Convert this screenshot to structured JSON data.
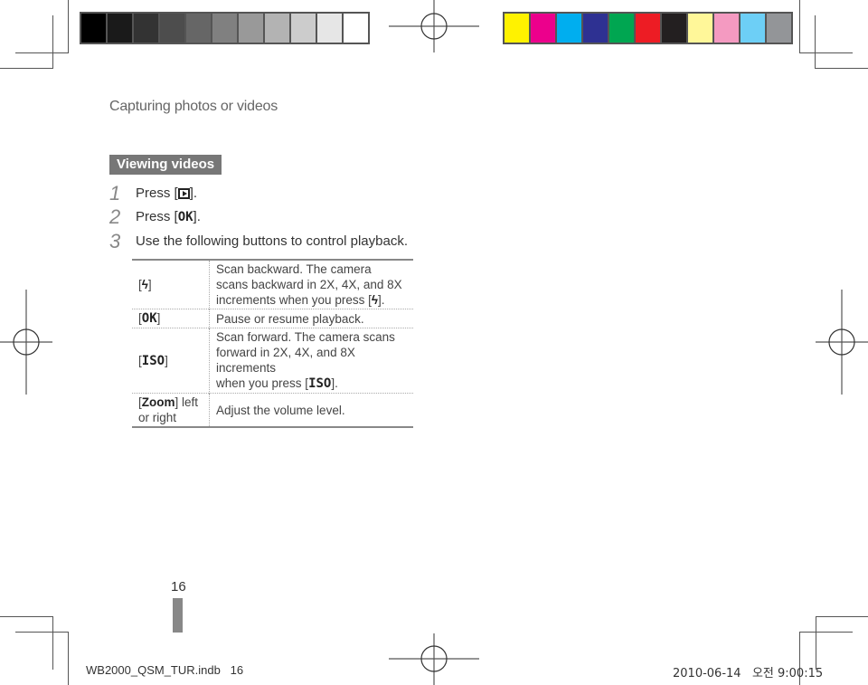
{
  "print_marks": {
    "grayscale_swatches": [
      "#000000",
      "#1a1a1a",
      "#333333",
      "#4d4d4d",
      "#666666",
      "#808080",
      "#999999",
      "#b3b3b3",
      "#cccccc",
      "#e6e6e6",
      "#ffffff"
    ],
    "color_swatches": [
      "#fff200",
      "#ec008c",
      "#00aeef",
      "#2e3192",
      "#00a651",
      "#ed1c24",
      "#231f20",
      "#fff799",
      "#f49ac1",
      "#6dcff6",
      "#939598"
    ]
  },
  "header": {
    "section_title": "Capturing photos or videos"
  },
  "main": {
    "heading": "Viewing videos",
    "steps": [
      {
        "num": "1",
        "before": "Press [",
        "icon": "play-icon",
        "after": "]."
      },
      {
        "num": "2",
        "before": "Press [",
        "key": "OK",
        "after": "]."
      },
      {
        "num": "3",
        "text": "Use the following buttons to control playback."
      }
    ],
    "table": {
      "rows": [
        {
          "key_before": "[",
          "key": "ϟ",
          "key_after": "]",
          "desc_lines": [
            "Scan backward. The camera",
            "scans backward in 2X, 4X, and 8X",
            "increments when you press ["
          ],
          "desc_key": "ϟ",
          "desc_end": "]."
        },
        {
          "key_before": "[",
          "key": "OK",
          "key_after": "]",
          "desc_lines": [
            "Pause or resume playback."
          ]
        },
        {
          "key_before": "[",
          "key": "ISO",
          "key_after": "]",
          "desc_lines": [
            "Scan forward. The camera scans",
            "forward in 2X, 4X, and 8X increments",
            "when you press ["
          ],
          "desc_key": "ISO",
          "desc_end": "]."
        },
        {
          "key_before": "[",
          "key": "Zoom",
          "key_after": "] left",
          "key_line2": "or right",
          "desc_lines": [
            "Adjust the volume level."
          ]
        }
      ]
    }
  },
  "page_number": "16",
  "footer": {
    "file_info": "WB2000_QSM_TUR.indb   16",
    "timestamp": "2010-06-14   오전 9:00:15"
  }
}
